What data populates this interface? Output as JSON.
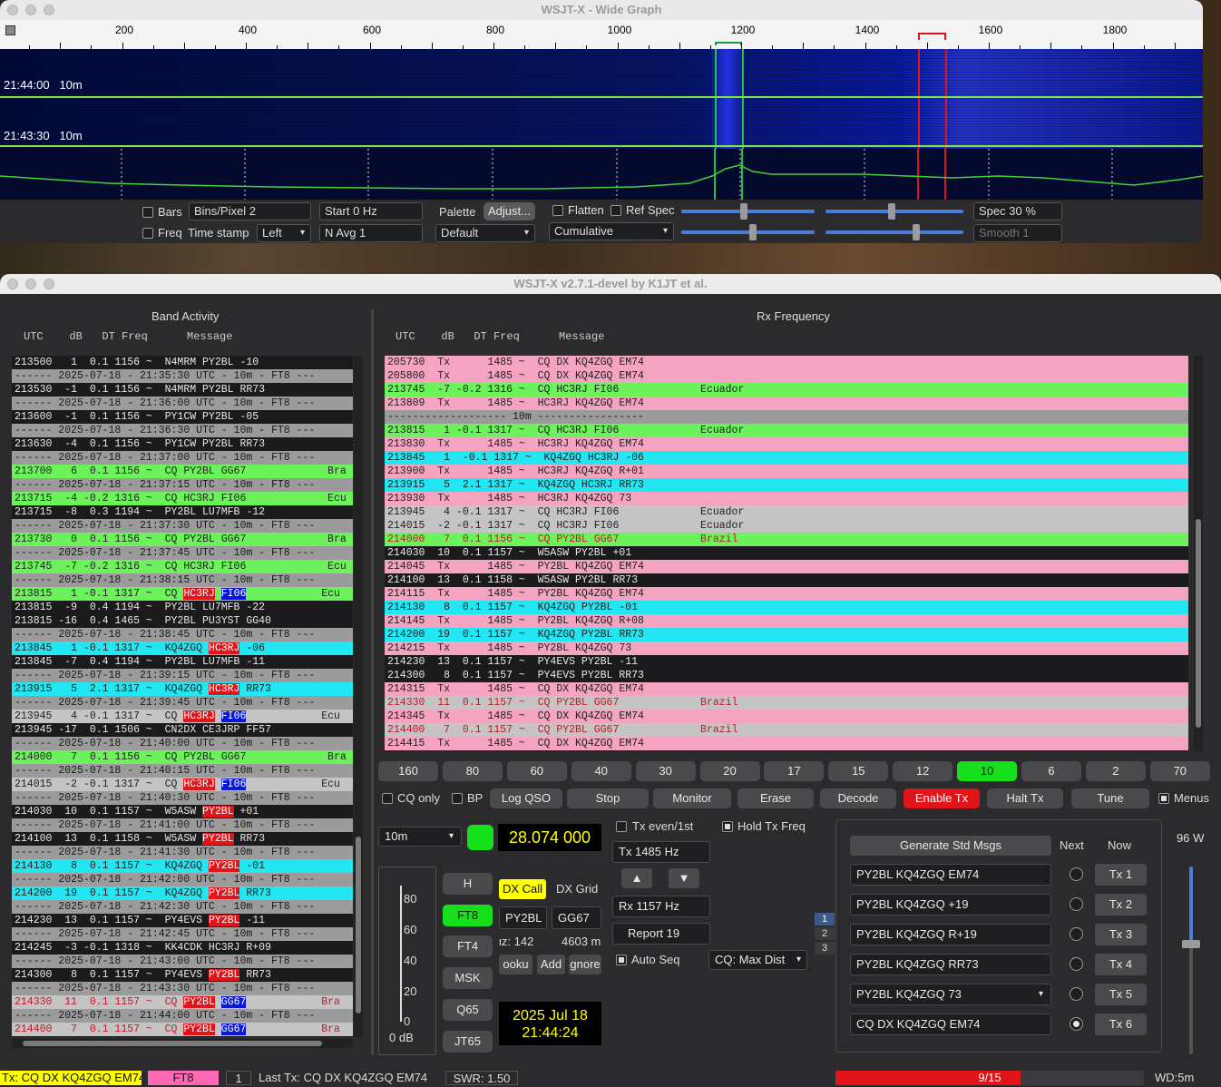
{
  "wide_graph": {
    "title": "WSJT-X - Wide Graph",
    "freq_scale": [
      "200",
      "400",
      "600",
      "800",
      "1000",
      "1200",
      "1400",
      "1600",
      "1800"
    ],
    "timestamps": [
      {
        "time": "21:44:00",
        "band": "10m"
      },
      {
        "time": "21:43:30",
        "band": "10m"
      }
    ],
    "controls": {
      "bars_label": "Bars",
      "freq_label": "Freq",
      "bins_pixel": "Bins/Pixel  2",
      "time_stamp_label": "Time stamp",
      "time_stamp_value": "Left",
      "start": "Start 0 Hz",
      "navg": "N Avg 1",
      "palette_label": "Palette",
      "adjust_label": "Adjust...",
      "palette_value": "Default",
      "flatten_label": "Flatten",
      "ref_spec_label": "Ref Spec",
      "cumulative": "Cumulative",
      "spec": "Spec 30 %",
      "smooth": "Smooth  1"
    }
  },
  "main": {
    "title": "WSJT-X   v2.7.1-devel   by K1JT et al.",
    "band_activity": {
      "title": "Band Activity",
      "header": "UTC    dB   DT Freq      Message",
      "rows": [
        {
          "t": "d",
          "text": "213500   1  0.1 1156 ~  N4MRM PY2BL -10"
        },
        {
          "t": "sep",
          "text": "------ 2025-07-18 - 21:35:30 UTC - 10m - FT8 ---"
        },
        {
          "t": "d",
          "text": "213530  -1  0.1 1156 ~  N4MRM PY2BL RR73"
        },
        {
          "t": "sep",
          "text": "------ 2025-07-18 - 21:36:00 UTC - 10m - FT8 ---"
        },
        {
          "t": "d",
          "text": "213600  -1  0.1 1156 ~  PY1CW PY2BL -05"
        },
        {
          "t": "sep",
          "text": "------ 2025-07-18 - 21:36:30 UTC - 10m - FT8 ---"
        },
        {
          "t": "d",
          "text": "213630  -4  0.1 1156 ~  PY1CW PY2BL RR73"
        },
        {
          "t": "sep",
          "text": "------ 2025-07-18 - 21:37:00 UTC - 10m - FT8 ---"
        },
        {
          "t": "cq",
          "text": "213700   6  0.1 1156 ~  CQ PY2BL GG67             Bra"
        },
        {
          "t": "sep",
          "text": "------ 2025-07-18 - 21:37:15 UTC - 10m - FT8 ---"
        },
        {
          "t": "cq",
          "text": "213715  -4 -0.2 1316 ~  CQ HC3RJ FI06             Ecu"
        },
        {
          "t": "d",
          "text": "213715  -8  0.3 1194 ~  PY2BL LU7MFB -12"
        },
        {
          "t": "sep",
          "text": "------ 2025-07-18 - 21:37:30 UTC - 10m - FT8 ---"
        },
        {
          "t": "cq",
          "text": "213730   0  0.1 1156 ~  CQ PY2BL GG67             Bra"
        },
        {
          "t": "sep",
          "text": "------ 2025-07-18 - 21:37:45 UTC - 10m - FT8 ---"
        },
        {
          "t": "cq",
          "text": "213745  -7 -0.2 1316 ~  CQ HC3RJ FI06             Ecu"
        },
        {
          "t": "sep",
          "text": "------ 2025-07-18 - 21:38:15 UTC - 10m - FT8 ---"
        },
        {
          "t": "cq",
          "pre": "213815   1 -0.1 1317 ~  CQ ",
          "r": "HC3RJ",
          "mid": " ",
          "b": "FI06",
          "post": "            Ecu"
        },
        {
          "t": "d",
          "text": "213815  -9  0.4 1194 ~  PY2BL LU7MFB -22"
        },
        {
          "t": "d",
          "text": "213815 -16  0.4 1465 ~  PY2BL PU3YST GG40"
        },
        {
          "t": "sep",
          "text": "------ 2025-07-18 - 21:38:45 UTC - 10m - FT8 ---"
        },
        {
          "t": "me",
          "pre": "213845   1 -0.1 1317 ~  KQ4ZGQ ",
          "r": "HC3RJ",
          "post": " -06"
        },
        {
          "t": "d",
          "text": "213845  -7  0.4 1194 ~  PY2BL LU7MFB -11"
        },
        {
          "t": "sep",
          "text": "------ 2025-07-18 - 21:39:15 UTC - 10m - FT8 ---"
        },
        {
          "t": "me",
          "pre": "213915   5  2.1 1317 ~  KQ4ZGQ ",
          "r": "HC3RJ",
          "post": " RR73"
        },
        {
          "t": "sep",
          "text": "------ 2025-07-18 - 21:39:45 UTC - 10m - FT8 ---"
        },
        {
          "t": "hi",
          "pre": "213945   4 -0.1 1317 ~  CQ ",
          "r": "HC3RJ",
          "mid": " ",
          "b": "FI06",
          "post": "            Ecu"
        },
        {
          "t": "d",
          "text": "213945 -17  0.1 1506 ~  CN2DX CE3JRP FF57"
        },
        {
          "t": "sep",
          "text": "------ 2025-07-18 - 21:40:00 UTC - 10m - FT8 ---"
        },
        {
          "t": "cq",
          "text": "214000   7  0.1 1156 ~  CQ PY2BL GG67             Bra"
        },
        {
          "t": "sep",
          "text": "------ 2025-07-18 - 21:40:15 UTC - 10m - FT8 ---"
        },
        {
          "t": "hi",
          "pre": "214015  -2 -0.1 1317 ~  CQ ",
          "r": "HC3RJ",
          "mid": " ",
          "b": "FI06",
          "post": "            Ecu"
        },
        {
          "t": "sep",
          "text": "------ 2025-07-18 - 21:40:30 UTC - 10m - FT8 ---"
        },
        {
          "t": "d",
          "pre": "214030  10  0.1 1157 ~  W5ASW ",
          "r": "PY2BL",
          "post": " +01"
        },
        {
          "t": "sep",
          "text": "------ 2025-07-18 - 21:41:00 UTC - 10m - FT8 ---"
        },
        {
          "t": "d",
          "pre": "214100  13  0.1 1158 ~  W5ASW ",
          "r": "PY2BL",
          "post": " RR73"
        },
        {
          "t": "sep",
          "text": "------ 2025-07-18 - 21:41:30 UTC - 10m - FT8 ---"
        },
        {
          "t": "me",
          "pre": "214130   8  0.1 1157 ~  KQ4ZGQ ",
          "r": "PY2BL",
          "post": " -01"
        },
        {
          "t": "sep",
          "text": "------ 2025-07-18 - 21:42:00 UTC - 10m - FT8 ---"
        },
        {
          "t": "me",
          "pre": "214200  19  0.1 1157 ~  KQ4ZGQ ",
          "r": "PY2BL",
          "post": " RR73"
        },
        {
          "t": "sep",
          "text": "------ 2025-07-18 - 21:42:30 UTC - 10m - FT8 ---"
        },
        {
          "t": "d",
          "pre": "214230  13  0.1 1157 ~  PY4EVS ",
          "r": "PY2BL",
          "post": " -11"
        },
        {
          "t": "sep",
          "text": "------ 2025-07-18 - 21:42:45 UTC - 10m - FT8 ---"
        },
        {
          "t": "d",
          "text": "214245  -3 -0.1 1318 ~  KK4CDK HC3RJ R+09"
        },
        {
          "t": "sep",
          "text": "------ 2025-07-18 - 21:43:00 UTC - 10m - FT8 ---"
        },
        {
          "t": "d",
          "pre": "214300   8  0.1 1157 ~  PY4EVS ",
          "r": "PY2BL",
          "post": " RR73"
        },
        {
          "t": "sep",
          "text": "------ 2025-07-18 - 21:43:30 UTC - 10m - FT8 ---"
        },
        {
          "t": "hired",
          "pre": "214330  11  0.1 1157 ~  CQ ",
          "r": "PY2BL",
          "mid": " ",
          "b": "GG67",
          "post": "            Bra"
        },
        {
          "t": "sep",
          "text": "------ 2025-07-18 - 21:44:00 UTC - 10m - FT8 ---"
        },
        {
          "t": "hired",
          "pre": "214400   7  0.1 1157 ~  CQ ",
          "r": "PY2BL",
          "mid": " ",
          "b": "GG67",
          "post": "            Bra"
        }
      ]
    },
    "rx_frequency": {
      "title": "Rx Frequency",
      "header": "UTC    dB   DT Freq      Message",
      "rows": [
        {
          "t": "tx",
          "text": "205730  Tx      1485 ~  CQ DX KQ4ZGQ EM74"
        },
        {
          "t": "tx",
          "text": "205800  Tx      1485 ~  CQ DX KQ4ZGQ EM74"
        },
        {
          "t": "cq",
          "text": "213745  -7 -0.2 1316 ~  CQ HC3RJ FI06             Ecuador"
        },
        {
          "t": "tx",
          "text": "213809  Tx      1485 ~  HC3RJ KQ4ZGQ EM74"
        },
        {
          "t": "sep",
          "text": "------------------- 10m -----------------"
        },
        {
          "t": "cq",
          "text": "213815   1 -0.1 1317 ~  CQ HC3RJ FI06             Ecuador"
        },
        {
          "t": "tx",
          "text": "213830  Tx      1485 ~  HC3RJ KQ4ZGQ EM74"
        },
        {
          "t": "me",
          "text": "213845   1  -0.1 1317 ~  KQ4ZGQ HC3RJ -06"
        },
        {
          "t": "tx",
          "text": "213900  Tx      1485 ~  HC3RJ KQ4ZGQ R+01"
        },
        {
          "t": "me",
          "text": "213915   5  2.1 1317 ~  KQ4ZGQ HC3RJ RR73"
        },
        {
          "t": "tx",
          "text": "213930  Tx      1485 ~  HC3RJ KQ4ZGQ 73"
        },
        {
          "t": "hi",
          "text": "213945   4 -0.1 1317 ~  CQ HC3RJ FI06             Ecuador"
        },
        {
          "t": "hi",
          "text": "214015  -2 -0.1 1317 ~  CQ HC3RJ FI06             Ecuador"
        },
        {
          "t": "cqred",
          "text": "214000   7  0.1 1156 ~  CQ PY2BL GG67             Brazil"
        },
        {
          "t": "d",
          "text": "214030  10  0.1 1157 ~  W5ASW PY2BL +01"
        },
        {
          "t": "tx",
          "text": "214045  Tx      1485 ~  PY2BL KQ4ZGQ EM74"
        },
        {
          "t": "d",
          "text": "214100  13  0.1 1158 ~  W5ASW PY2BL RR73"
        },
        {
          "t": "tx",
          "text": "214115  Tx      1485 ~  PY2BL KQ4ZGQ EM74"
        },
        {
          "t": "me",
          "text": "214130   8  0.1 1157 ~  KQ4ZGQ PY2BL -01"
        },
        {
          "t": "tx",
          "text": "214145  Tx      1485 ~  PY2BL KQ4ZGQ R+08"
        },
        {
          "t": "me",
          "text": "214200  19  0.1 1157 ~  KQ4ZGQ PY2BL RR73"
        },
        {
          "t": "tx",
          "text": "214215  Tx      1485 ~  PY2BL KQ4ZGQ 73"
        },
        {
          "t": "d",
          "text": "214230  13  0.1 1157 ~  PY4EVS PY2BL -11"
        },
        {
          "t": "d",
          "text": "214300   8  0.1 1157 ~  PY4EVS PY2BL RR73"
        },
        {
          "t": "tx",
          "text": "214315  Tx      1485 ~  CQ DX KQ4ZGQ EM74"
        },
        {
          "t": "hired",
          "text": "214330  11  0.1 1157 ~  CQ PY2BL GG67             Brazil"
        },
        {
          "t": "tx",
          "text": "214345  Tx      1485 ~  CQ DX KQ4ZGQ EM74"
        },
        {
          "t": "hired",
          "text": "214400   7  0.1 1157 ~  CQ PY2BL GG67             Brazil"
        },
        {
          "t": "tx",
          "text": "214415  Tx      1485 ~  CQ DX KQ4ZGQ EM74"
        }
      ]
    },
    "bands": [
      "160",
      "80",
      "60",
      "40",
      "30",
      "20",
      "17",
      "15",
      "12",
      "10",
      "6",
      "2",
      "70"
    ],
    "active_band": "10",
    "controls": {
      "cq_only": "CQ only",
      "bp": "BP",
      "log_qso": "Log QSO",
      "stop": "Stop",
      "monitor": "Monitor",
      "erase": "Erase",
      "decode": "Decode",
      "enable_tx": "Enable Tx",
      "halt_tx": "Halt Tx",
      "tune": "Tune",
      "menus": "Menus"
    },
    "band_select": "10m",
    "dial_freq": "28.074 000",
    "tx_even": "Tx even/1st",
    "hold_tx": "Hold Tx Freq",
    "tx_freq": "Tx  1485  Hz",
    "rx_freq": "Rx  1157  Hz",
    "report": "Report 19",
    "auto_seq": "Auto Seq",
    "cq_mode": "CQ: Max Dist",
    "meter_scale": [
      "80",
      "60",
      "40",
      "20",
      "0"
    ],
    "meter_label": "0 dB",
    "modes": [
      "H",
      "FT8",
      "FT4",
      "MSK",
      "Q65",
      "JT65"
    ],
    "active_mode": "FT8",
    "dx_call_label": "DX Call",
    "dx_grid_label": "DX Grid",
    "dx_call": "PY2BL",
    "dx_grid": "GG67",
    "az": "ιz: 142",
    "dist": "4603 m",
    "lookup": "ooku",
    "add": "Add",
    "ignore": "gnore",
    "date": "2025 Jul 18",
    "time": "21:44:24",
    "tab_labels": [
      "1",
      "2",
      "3"
    ],
    "gen_std": "Generate Std Msgs",
    "next_label": "Next",
    "now_label": "Now",
    "messages": [
      {
        "text": "PY2BL KQ4ZGQ EM74",
        "btn": "Tx 1",
        "selected": false
      },
      {
        "text": "PY2BL KQ4ZGQ +19",
        "btn": "Tx 2",
        "selected": false
      },
      {
        "text": "PY2BL KQ4ZGQ R+19",
        "btn": "Tx 3",
        "selected": false
      },
      {
        "text": "PY2BL KQ4ZGQ RR73",
        "btn": "Tx 4",
        "selected": false
      },
      {
        "text": "PY2BL KQ4ZGQ 73",
        "btn": "Tx 5",
        "selected": false
      },
      {
        "text": "CQ DX KQ4ZGQ EM74",
        "btn": "Tx 6",
        "selected": true
      }
    ],
    "power": "96 W"
  },
  "status_bar": {
    "tx": "Tx: CQ DX KQ4ZGQ EM74",
    "mode": "FT8",
    "count": "1",
    "last_tx": "Last Tx: CQ DX KQ4ZGQ EM74",
    "swr": "SWR: 1.50",
    "progress": "9/15",
    "progress_fraction": 0.6,
    "wd": "WD:5m"
  }
}
